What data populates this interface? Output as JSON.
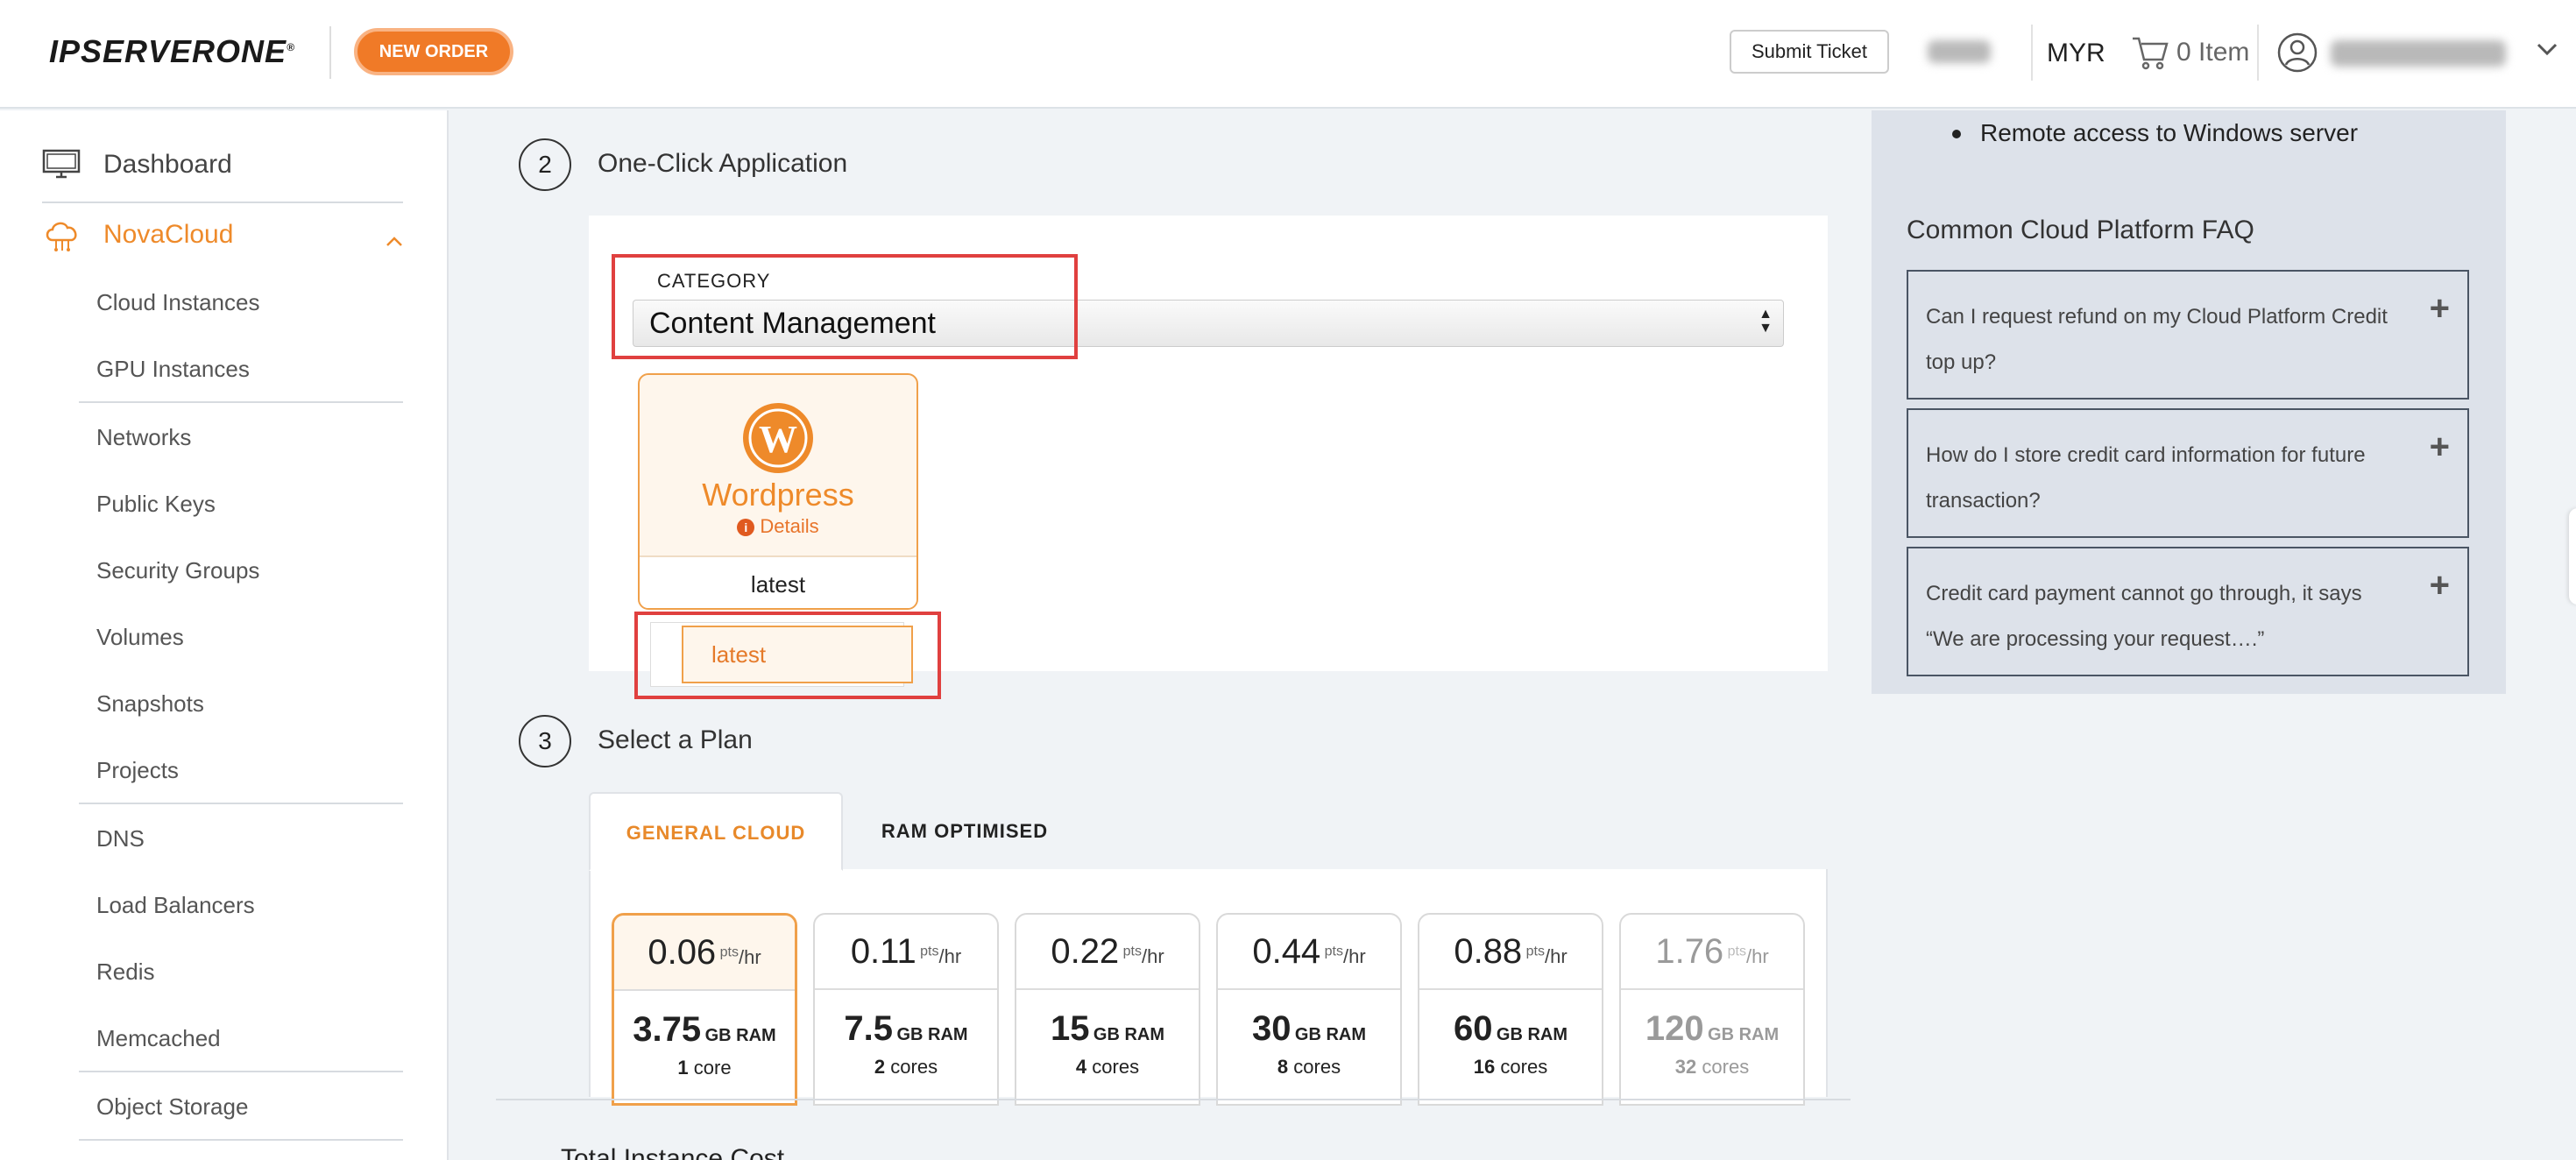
{
  "header": {
    "logo_text": "IPSERVERONE",
    "logo_reg": "®",
    "new_order_label": "NEW ORDER",
    "submit_ticket_label": "Submit Ticket",
    "currency": "MYR",
    "cart_label": "0 Item"
  },
  "sidebar": {
    "dashboard": "Dashboard",
    "group": "NovaCloud",
    "items": [
      "Cloud Instances",
      "GPU Instances",
      "Networks",
      "Public Keys",
      "Security Groups",
      "Volumes",
      "Snapshots",
      "Projects",
      "DNS",
      "Load Balancers",
      "Redis",
      "Memcached",
      "Object Storage"
    ]
  },
  "step2": {
    "number": "2",
    "title": "One-Click Application",
    "category_label": "CATEGORY",
    "category_value": "Content Management",
    "app": {
      "name": "Wordpress",
      "details": "Details",
      "version_selected": "latest",
      "version_option": "latest"
    }
  },
  "step3": {
    "number": "3",
    "title": "Select a Plan",
    "tabs": [
      "GENERAL CLOUD",
      "RAM OPTIMISED"
    ],
    "plans": [
      {
        "price": "0.06",
        "ram": "3.75",
        "cores": "1",
        "cores_unit": "core"
      },
      {
        "price": "0.11",
        "ram": "7.5",
        "cores": "2",
        "cores_unit": "cores"
      },
      {
        "price": "0.22",
        "ram": "15",
        "cores": "4",
        "cores_unit": "cores"
      },
      {
        "price": "0.44",
        "ram": "30",
        "cores": "8",
        "cores_unit": "cores"
      },
      {
        "price": "0.88",
        "ram": "60",
        "cores": "16",
        "cores_unit": "cores"
      },
      {
        "price": "1.76",
        "ram": "120",
        "cores": "32",
        "cores_unit": "cores"
      }
    ],
    "price_unit_sup": "pts",
    "price_unit": "/hr",
    "ram_unit": "GB RAM"
  },
  "footer": {
    "total_cost_label": "Total Instance Cost"
  },
  "right_panel": {
    "bullet": "Remote access to Windows server",
    "faq_title": "Common Cloud Platform FAQ",
    "faqs": [
      "Can I request refund on my Cloud Platform Credit top up?",
      "How do I store credit card information for future transaction?",
      "Credit card payment cannot go through, it says “We are processing your request….”"
    ]
  },
  "colors": {
    "accent": "#f07a27",
    "highlight_red": "#e0403f",
    "faq_bg": "#dde2ea"
  }
}
